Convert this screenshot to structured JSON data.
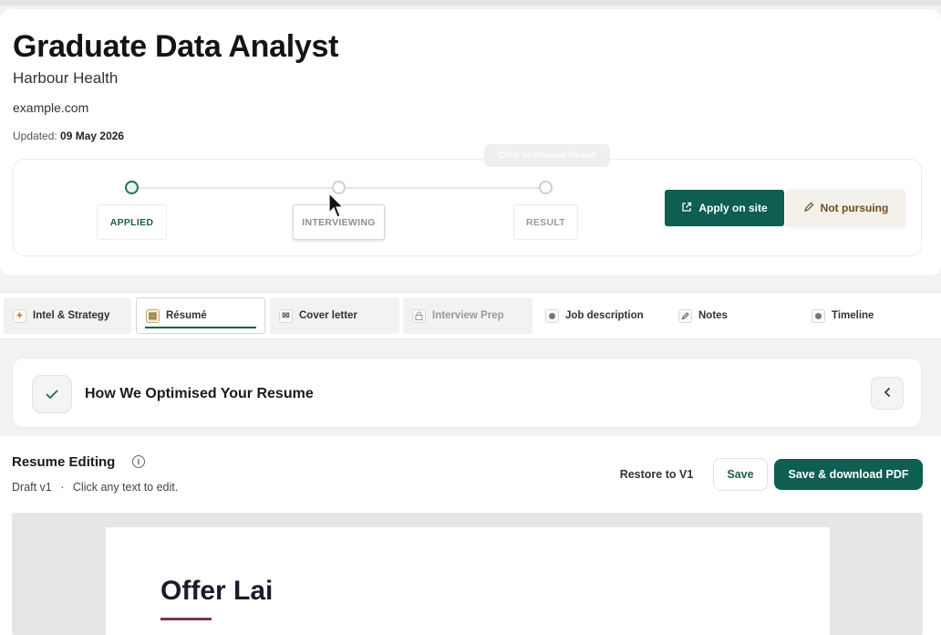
{
  "job": {
    "title": "Graduate Data Analyst",
    "company": "Harbour Health",
    "site": "example.com",
    "updated_label": "Updated:",
    "updated_date": "09 May 2026"
  },
  "stages": {
    "tooltip": "Click to choose Result",
    "items": [
      {
        "label": "APPLIED",
        "state": "active"
      },
      {
        "label": "INTERVIEWING",
        "state": "pending"
      },
      {
        "label": "RESULT",
        "state": "pending"
      }
    ]
  },
  "actions": {
    "apply_label": "Apply on site",
    "not_pursuing_label": "Not pursuing"
  },
  "tabs": [
    {
      "label": "Intel & Strategy",
      "icon": "sparkle-icon"
    },
    {
      "label": "Résumé",
      "icon": "document-icon",
      "selected": true
    },
    {
      "label": "Cover letter",
      "icon": "envelope-icon"
    },
    {
      "label": "Interview Prep",
      "icon": "lock-icon",
      "disabled": true
    },
    {
      "label": "Job description",
      "icon": "dot-icon"
    },
    {
      "label": "Notes",
      "icon": "pencil-icon"
    },
    {
      "label": "Timeline",
      "icon": "dot-icon"
    }
  ],
  "optimised": {
    "title": "How We Optimised Your Resume"
  },
  "editing": {
    "title": "Resume Editing",
    "draft": "Draft v1",
    "hint": "Click any text to edit.",
    "restore_label": "Restore to V1",
    "save_label": "Save",
    "save_pdf_label": "Save & download PDF"
  },
  "resume": {
    "name": "Offer Lai"
  },
  "colors": {
    "brand": "#0e5e52",
    "accent_rule": "#7b3548",
    "not_pursuing_text": "#6b4f1f"
  }
}
